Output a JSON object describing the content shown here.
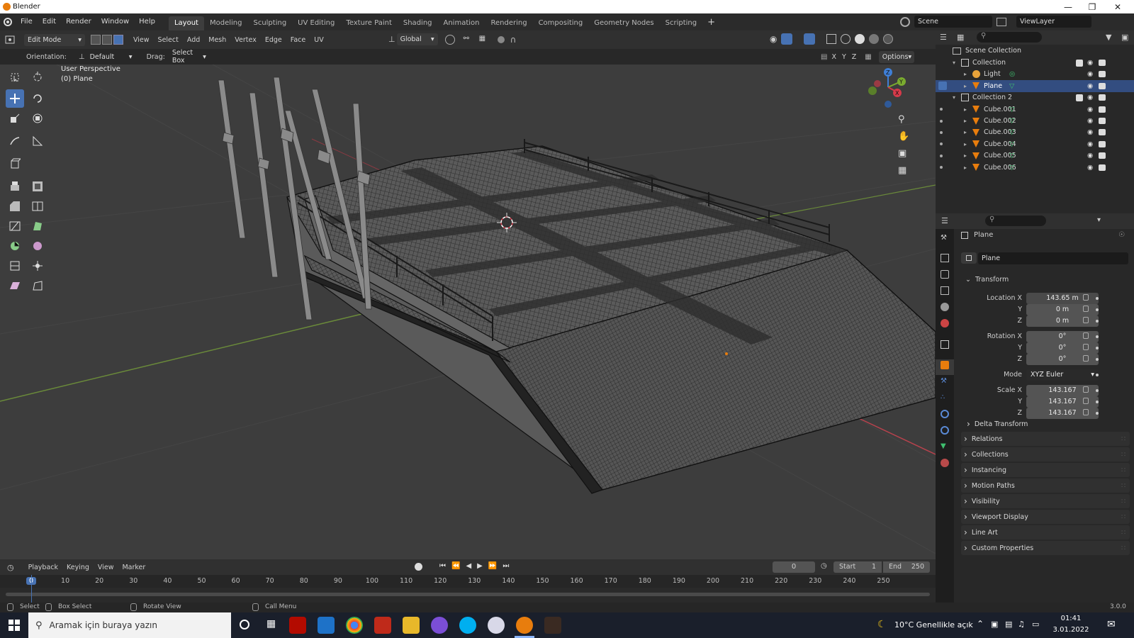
{
  "window": {
    "title": "Blender"
  },
  "menu": [
    "File",
    "Edit",
    "Render",
    "Window",
    "Help"
  ],
  "workspaces": [
    "Layout",
    "Modeling",
    "Sculpting",
    "UV Editing",
    "Texture Paint",
    "Shading",
    "Animation",
    "Rendering",
    "Compositing",
    "Geometry Nodes",
    "Scripting"
  ],
  "topbar_right": {
    "scene": "Scene",
    "view_layer": "ViewLayer"
  },
  "header": {
    "mode": "Edit Mode",
    "menus": [
      "View",
      "Select",
      "Add",
      "Mesh",
      "Vertex",
      "Edge",
      "Face",
      "UV"
    ],
    "transform_orientation": "Global",
    "options": "Options",
    "axes": [
      "X",
      "Y",
      "Z"
    ]
  },
  "tool_options": {
    "orientation_label": "Orientation:",
    "orientation_value": "Default",
    "drag_label": "Drag:",
    "drag_value": "Select Box"
  },
  "viewport": {
    "perspective": "User Perspective",
    "object": "(0) Plane"
  },
  "outliner": {
    "root": "Scene Collection",
    "items": [
      {
        "name": "Collection",
        "type": "collection"
      },
      {
        "name": "Light",
        "type": "light"
      },
      {
        "name": "Plane",
        "type": "mesh",
        "selected": true
      },
      {
        "name": "Collection 2",
        "type": "collection"
      },
      {
        "name": "Cube.001",
        "type": "mesh"
      },
      {
        "name": "Cube.002",
        "type": "mesh"
      },
      {
        "name": "Cube.003",
        "type": "mesh"
      },
      {
        "name": "Cube.004",
        "type": "mesh"
      },
      {
        "name": "Cube.005",
        "type": "mesh"
      },
      {
        "name": "Cube.006",
        "type": "mesh"
      }
    ]
  },
  "properties": {
    "object_name": "Plane",
    "data_name": "Plane",
    "transform_label": "Transform",
    "location": {
      "label": "Location X",
      "x": "143.65 m",
      "y": "0 m",
      "z": "0 m"
    },
    "rotation": {
      "label": "Rotation X",
      "x": "0°",
      "y": "0°",
      "z": "0°"
    },
    "mode_label": "Mode",
    "mode_value": "XYZ Euler",
    "scale": {
      "label": "Scale X",
      "x": "143.167",
      "y": "143.167",
      "z": "143.167"
    },
    "axis_y": "Y",
    "axis_z": "Z",
    "panels": [
      "Delta Transform",
      "Relations",
      "Collections",
      "Instancing",
      "Motion Paths",
      "Visibility",
      "Viewport Display",
      "Line Art",
      "Custom Properties"
    ]
  },
  "timeline": {
    "menus": [
      "Playback",
      "Keying",
      "View",
      "Marker"
    ],
    "current_frame": "0",
    "start_label": "Start",
    "start": "1",
    "end_label": "End",
    "end": "250",
    "ruler": [
      "0",
      "10",
      "20",
      "30",
      "40",
      "50",
      "60",
      "70",
      "80",
      "90",
      "100",
      "110",
      "120",
      "130",
      "140",
      "150",
      "160",
      "170",
      "180",
      "190",
      "200",
      "210",
      "220",
      "230",
      "240",
      "250"
    ]
  },
  "statusbar": {
    "items": [
      "Select",
      "Box Select",
      "Rotate View",
      "Call Menu"
    ],
    "version": "3.0.0"
  },
  "taskbar": {
    "search_placeholder": "Aramak için buraya yazın",
    "weather": "10°C  Genellikle açık",
    "time": "01:41",
    "date": "3.01.2022"
  },
  "colors": {
    "accent": "#4772b3",
    "selected_row": "#334d80",
    "viewport_bg": "#3d3d3d",
    "orange": "#e87d0d",
    "x_axis": "#d63a4a",
    "y_axis": "#7aab2f",
    "z_axis": "#3f7fd6"
  }
}
